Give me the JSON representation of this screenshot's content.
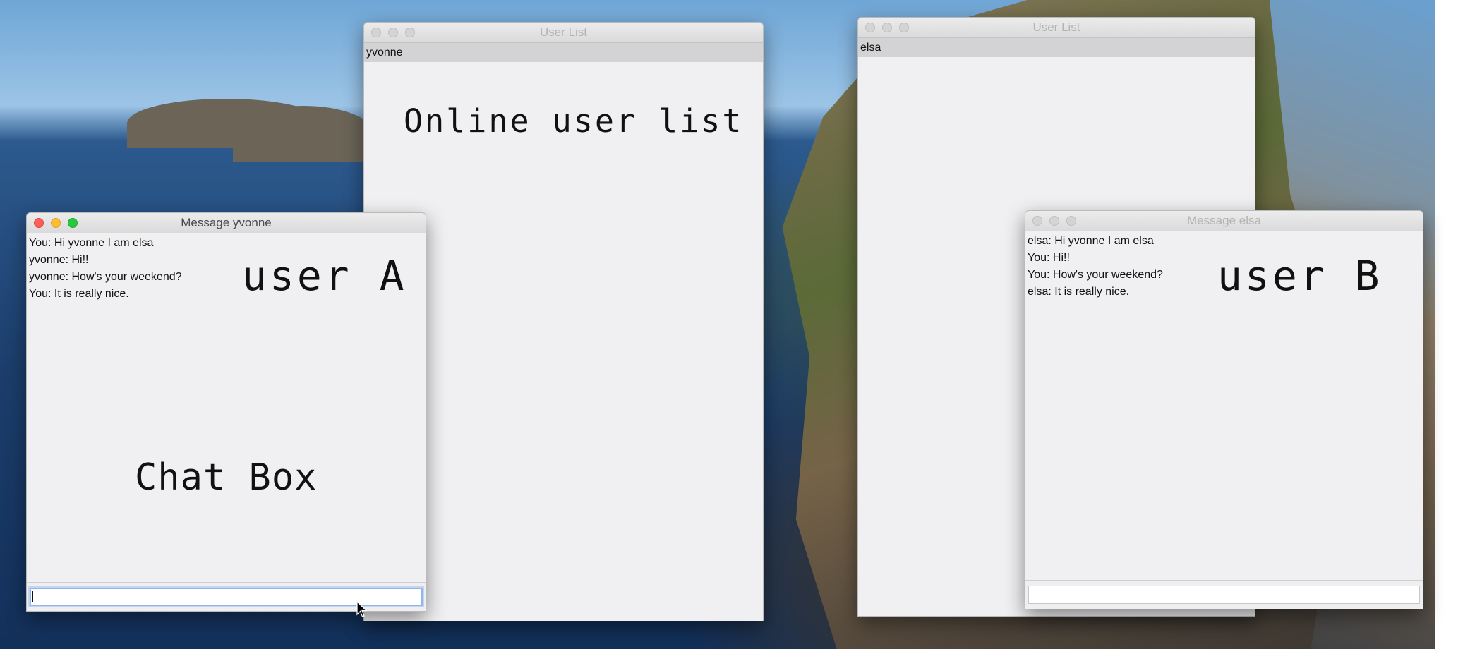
{
  "user_list_a": {
    "title": "User List",
    "users": [
      "yvonne"
    ],
    "annotation": "Online user list"
  },
  "user_list_b": {
    "title": "User List",
    "users": [
      "elsa"
    ]
  },
  "chat_a": {
    "title": "Message yvonne",
    "messages": [
      "You: Hi yvonne I am elsa",
      "yvonne: Hi!!",
      "yvonne: How's your weekend?",
      "You: It is really nice."
    ],
    "annotation_user": "user A",
    "annotation_box": "Chat Box",
    "input_value": ""
  },
  "chat_b": {
    "title": "Message elsa",
    "messages": [
      "elsa: Hi yvonne I am elsa",
      "You: Hi!!",
      "You: How's your weekend?",
      "elsa: It is really nice."
    ],
    "annotation_user": "user B",
    "input_value": ""
  },
  "colors": {
    "close": "#fe5f57",
    "minimize": "#febc2e",
    "maximize": "#28c840",
    "selection": "#d3d3d5",
    "focus_ring": "#8fb6ee"
  },
  "icons": [
    "window-close-icon",
    "window-minimize-icon",
    "window-maximize-icon",
    "mouse-pointer-icon"
  ]
}
